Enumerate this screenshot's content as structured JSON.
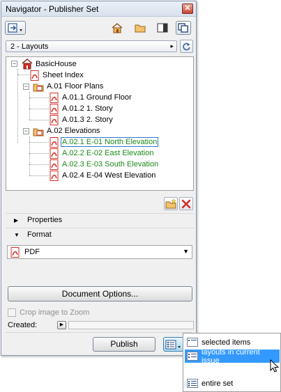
{
  "window": {
    "title": "Navigator - Publisher Set",
    "close_glyph": "✕"
  },
  "toolbar": {
    "icons": [
      "publish-set-menu-icon",
      "project-map-icon",
      "view-map-icon",
      "layout-book-icon",
      "publisher-sets-icon"
    ]
  },
  "set_selector": {
    "value": "2 - Layouts",
    "arrow": "▸"
  },
  "tree": {
    "root": "BasicHouse",
    "items": [
      {
        "label": "Sheet Index",
        "status": "normal"
      },
      {
        "label": "A.01 Floor Plans",
        "status": "folder"
      },
      {
        "label": "A.01.1 Ground Floor",
        "status": "normal"
      },
      {
        "label": "A.01.2 1. Story",
        "status": "normal"
      },
      {
        "label": "A.01.3 2. Story",
        "status": "normal"
      },
      {
        "label": "A.02 Elevations",
        "status": "folder"
      },
      {
        "label": "A.02.1 E-01 North Elevation",
        "status": "green-selected"
      },
      {
        "label": "A.02.2 E-02 East Elevation",
        "status": "green"
      },
      {
        "label": "A.02.3 E-03 South Elevation",
        "status": "green"
      },
      {
        "label": "A.02.4 E-04 West Elevation",
        "status": "normal"
      }
    ],
    "expander_glyph": "−"
  },
  "sections": {
    "properties": "Properties",
    "format": "Format",
    "collapsed_glyph": "▶",
    "expanded_glyph": "▼"
  },
  "format": {
    "value": "PDF",
    "arrow": "▼"
  },
  "document_options": "Document Options...",
  "crop": {
    "label": "Crop image to Zoom",
    "checked": false
  },
  "created": {
    "label": "Created:",
    "play_glyph": "▶"
  },
  "publish_button": "Publish",
  "publish_menu": {
    "items": [
      {
        "label": "selected items",
        "highlighted": false
      },
      {
        "label": "layouts in current issue",
        "highlighted": true
      },
      {
        "label": "entire set",
        "highlighted": false
      }
    ]
  },
  "colors": {
    "accent": "#3399ff",
    "green_item": "#1a8a1a",
    "pdf_red": "#d22f27"
  }
}
